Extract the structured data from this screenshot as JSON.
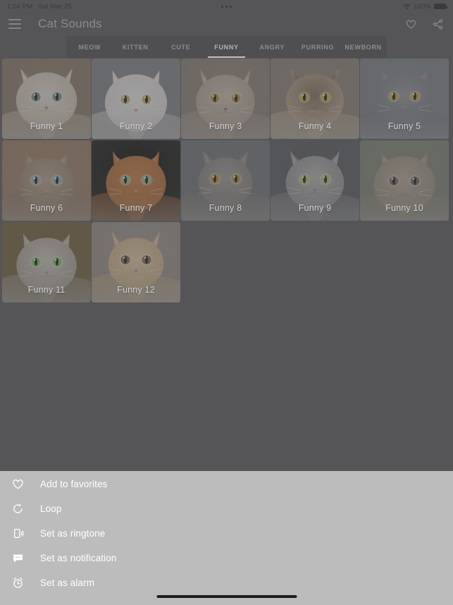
{
  "statusbar": {
    "time": "1:04 PM",
    "date": "Sat Mar 25",
    "battery_percent": "100%",
    "wifi_icon": "wifi-icon",
    "battery_icon": "battery-full-icon",
    "center_indicator": "three-dots-indicator"
  },
  "appbar": {
    "menu_icon": "hamburger-menu-icon",
    "title": "Cat Sounds",
    "favorite_icon": "heart-outline-icon",
    "share_icon": "share-icon"
  },
  "tabs": [
    {
      "label": "MEOW",
      "active": false
    },
    {
      "label": "KITTEN",
      "active": false
    },
    {
      "label": "CUTE",
      "active": false
    },
    {
      "label": "FUNNY",
      "active": true
    },
    {
      "label": "ANGRY",
      "active": false
    },
    {
      "label": "PURRING",
      "active": false
    },
    {
      "label": "NEWBORN",
      "active": false
    }
  ],
  "grid": {
    "items": [
      {
        "label": "Funny 1",
        "bg": "#8d7a63",
        "fur": "#e6ddd2",
        "fur2": "#c9bcab",
        "eye": "#6f8f93",
        "nose": "#b08b86"
      },
      {
        "label": "Funny 2",
        "bg": "#7f8489",
        "fur": "#f2f0ee",
        "fur2": "#dcd8d4",
        "eye": "#c9b44f",
        "nose": "#d98f96"
      },
      {
        "label": "Funny 3",
        "bg": "#8c8074",
        "fur": "#cdbdae",
        "fur2": "#a8998b",
        "eye": "#b99038",
        "nose": "#8a7064"
      },
      {
        "label": "Funny 4",
        "bg": "#8e8175",
        "fur": "#7e6a55",
        "fur2": "#c3ae95",
        "eye": "#c9b23f",
        "nose": "#8a6f5e"
      },
      {
        "label": "Funny 5",
        "bg": "#7c8188",
        "fur": "#8f9399",
        "fur2": "#6f747b",
        "eye": "#c6a63c",
        "nose": "#c27a86"
      },
      {
        "label": "Funny 6",
        "bg": "#a07d60",
        "fur": "#b6a08a",
        "fur2": "#8d7760",
        "eye": "#8fb0b6",
        "nose": "#c29a91"
      },
      {
        "label": "Funny 7",
        "bg": "#a5apple",
        "fur": "#c87a3e",
        "fur2": "#a85f28",
        "eye": "#89bc8e",
        "nose": "#d08d94"
      },
      {
        "label": "Funny 8",
        "bg": "#6e7176",
        "fur": "#9e9a96",
        "fur2": "#7d7975",
        "eye": "#c0912f",
        "nose": "#94857e"
      },
      {
        "label": "Funny 9",
        "bg": "#4f5156",
        "fur": "#b4b4b2",
        "fur2": "#86868a",
        "eye": "#b8bf5a",
        "nose": "#9c7e7c"
      },
      {
        "label": "Funny 10",
        "bg": "#7d8472",
        "fur": "#b3a795",
        "fur2": "#8d8474",
        "eye": "#6a6a5e",
        "nose": "#c08a90"
      },
      {
        "label": "Funny 11",
        "bg": "#6e5a2c",
        "fur": "#cdc6bc",
        "fur2": "#9b958c",
        "eye": "#7fc06a",
        "nose": "#b08f85"
      },
      {
        "label": "Funny 12",
        "bg": "#9c938c",
        "fur": "#e3c79f",
        "fur2": "#c3a87f",
        "eye": "#7d6648",
        "nose": "#b9868e"
      }
    ]
  },
  "sheet": {
    "items": [
      {
        "label": "Add to favorites",
        "icon": "heart-outline-icon"
      },
      {
        "label": "Loop",
        "icon": "loop-icon"
      },
      {
        "label": "Set as ringtone",
        "icon": "phone-vibrate-icon"
      },
      {
        "label": "Set as notification",
        "icon": "chat-bubble-icon"
      },
      {
        "label": "Set as alarm",
        "icon": "alarm-clock-icon"
      }
    ]
  },
  "home_indicator": "home-indicator-bar"
}
